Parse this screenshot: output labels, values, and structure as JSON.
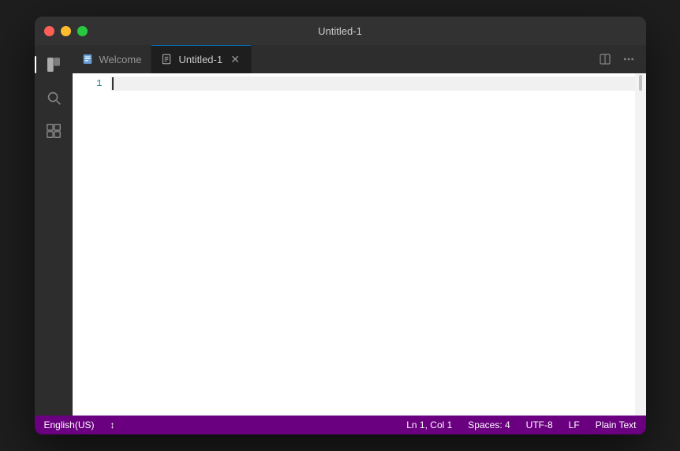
{
  "window": {
    "title": "Untitled-1"
  },
  "titlebar": {
    "close_label": "",
    "minimize_label": "",
    "maximize_label": ""
  },
  "activity_bar": {
    "icons": [
      {
        "name": "explorer-icon",
        "symbol": "📄",
        "active": true
      },
      {
        "name": "search-icon",
        "symbol": "🔍",
        "active": false
      },
      {
        "name": "extensions-icon",
        "symbol": "⊞",
        "active": false
      }
    ]
  },
  "tabs": [
    {
      "id": "welcome",
      "label": "Welcome",
      "icon": "📋",
      "active": false,
      "closable": false
    },
    {
      "id": "untitled-1",
      "label": "Untitled-1",
      "icon": "📝",
      "active": true,
      "closable": true
    }
  ],
  "tab_bar_actions": {
    "split_editor": "⊟",
    "more_actions": "···"
  },
  "editor": {
    "line_numbers": [
      "1"
    ],
    "content": ""
  },
  "status_bar": {
    "language": "English(US)",
    "sync_icon": "↕",
    "position": "Ln 1, Col 1",
    "spaces": "Spaces: 4",
    "encoding": "UTF-8",
    "line_ending": "LF",
    "language_mode": "Plain Text"
  }
}
